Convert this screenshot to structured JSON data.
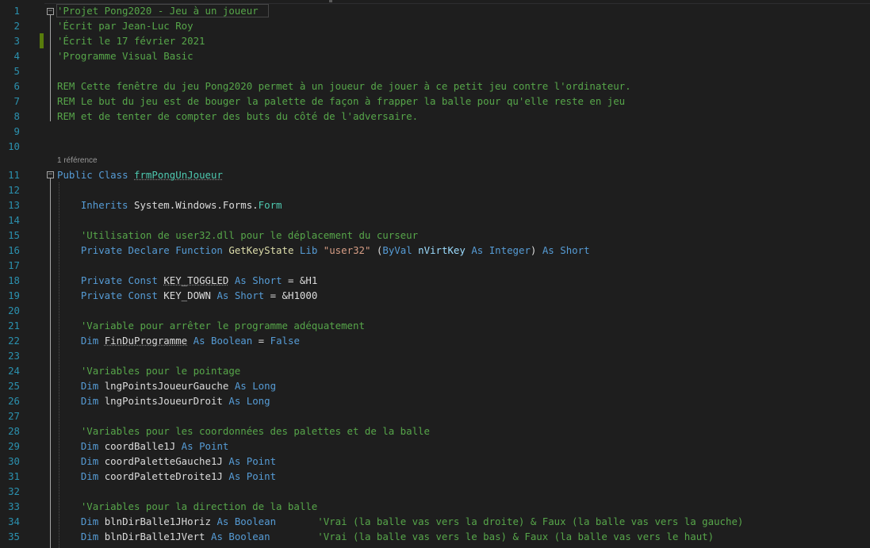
{
  "editor": {
    "codelens": "1 référence",
    "colors": {
      "background": "#1e1e1e",
      "line_number": "#2b91af",
      "keyword": "#569cd6",
      "comment": "#57a64a",
      "type": "#4ec9b0",
      "string": "#d69d85",
      "change_marker": "#587c0c"
    }
  },
  "lines": [
    {
      "n": "1",
      "tokens": [
        {
          "c": "cm",
          "t": "'Projet Pong2020 - Jeu à un joueur"
        }
      ]
    },
    {
      "n": "2",
      "tokens": [
        {
          "c": "cm",
          "t": "'Écrit par Jean-Luc Roy"
        }
      ]
    },
    {
      "n": "3",
      "tokens": [
        {
          "c": "cm",
          "t": "'Écrit le 17 février 2021"
        }
      ]
    },
    {
      "n": "4",
      "tokens": [
        {
          "c": "cm",
          "t": "'Programme Visual Basic"
        }
      ]
    },
    {
      "n": "5",
      "tokens": []
    },
    {
      "n": "6",
      "tokens": [
        {
          "c": "cm",
          "t": "REM Cette fenêtre du jeu Pong2020 permet à un joueur de jouer à ce petit jeu contre l'ordinateur."
        }
      ]
    },
    {
      "n": "7",
      "tokens": [
        {
          "c": "cm",
          "t": "REM Le but du jeu est de bouger la palette de façon à frapper la balle pour qu'elle reste en jeu"
        }
      ]
    },
    {
      "n": "8",
      "tokens": [
        {
          "c": "cm",
          "t": "REM et de tenter de compter des buts du côté de l'adversaire."
        }
      ]
    },
    {
      "n": "9",
      "tokens": []
    },
    {
      "n": "10",
      "tokens": []
    },
    {
      "n": "11",
      "tokens": [
        {
          "c": "kw",
          "t": "Public"
        },
        {
          "c": "tx",
          "t": " "
        },
        {
          "c": "kw",
          "t": "Class"
        },
        {
          "c": "tx",
          "t": " "
        },
        {
          "c": "ty squig",
          "t": "frmPongUnJoueur"
        }
      ]
    },
    {
      "n": "12",
      "tokens": []
    },
    {
      "n": "13",
      "tokens": [
        {
          "c": "tx",
          "t": "    "
        },
        {
          "c": "kw",
          "t": "Inherits"
        },
        {
          "c": "tx",
          "t": " System.Windows.Forms."
        },
        {
          "c": "ty",
          "t": "Form"
        }
      ]
    },
    {
      "n": "14",
      "tokens": []
    },
    {
      "n": "15",
      "tokens": [
        {
          "c": "tx",
          "t": "    "
        },
        {
          "c": "cm",
          "t": "'Utilisation de user32.dll pour le déplacement du curseur"
        }
      ]
    },
    {
      "n": "16",
      "tokens": [
        {
          "c": "tx",
          "t": "    "
        },
        {
          "c": "kw",
          "t": "Private"
        },
        {
          "c": "tx",
          "t": " "
        },
        {
          "c": "kw",
          "t": "Declare"
        },
        {
          "c": "tx",
          "t": " "
        },
        {
          "c": "kw",
          "t": "Function"
        },
        {
          "c": "tx",
          "t": " "
        },
        {
          "c": "fn",
          "t": "GetKeyState"
        },
        {
          "c": "tx",
          "t": " "
        },
        {
          "c": "kw",
          "t": "Lib"
        },
        {
          "c": "tx",
          "t": " "
        },
        {
          "c": "st",
          "t": "\"user32\""
        },
        {
          "c": "tx",
          "t": " ("
        },
        {
          "c": "kw",
          "t": "ByVal"
        },
        {
          "c": "tx",
          "t": " "
        },
        {
          "c": "pm",
          "t": "nVirtKey"
        },
        {
          "c": "tx",
          "t": " "
        },
        {
          "c": "kw",
          "t": "As"
        },
        {
          "c": "tx",
          "t": " "
        },
        {
          "c": "kw",
          "t": "Integer"
        },
        {
          "c": "tx",
          "t": ") "
        },
        {
          "c": "kw",
          "t": "As"
        },
        {
          "c": "tx",
          "t": " "
        },
        {
          "c": "kw",
          "t": "Short"
        }
      ]
    },
    {
      "n": "17",
      "tokens": []
    },
    {
      "n": "18",
      "tokens": [
        {
          "c": "tx",
          "t": "    "
        },
        {
          "c": "kw",
          "t": "Private"
        },
        {
          "c": "tx",
          "t": " "
        },
        {
          "c": "kw",
          "t": "Const"
        },
        {
          "c": "tx",
          "t": " "
        },
        {
          "c": "tx squig",
          "t": "KEY_TOGGLED"
        },
        {
          "c": "tx",
          "t": " "
        },
        {
          "c": "kw",
          "t": "As"
        },
        {
          "c": "tx",
          "t": " "
        },
        {
          "c": "kw",
          "t": "Short"
        },
        {
          "c": "tx",
          "t": " = &H1"
        }
      ]
    },
    {
      "n": "19",
      "tokens": [
        {
          "c": "tx",
          "t": "    "
        },
        {
          "c": "kw",
          "t": "Private"
        },
        {
          "c": "tx",
          "t": " "
        },
        {
          "c": "kw",
          "t": "Const"
        },
        {
          "c": "tx",
          "t": " KEY_DOWN "
        },
        {
          "c": "kw",
          "t": "As"
        },
        {
          "c": "tx",
          "t": " "
        },
        {
          "c": "kw",
          "t": "Short"
        },
        {
          "c": "tx",
          "t": " = &H1000"
        }
      ]
    },
    {
      "n": "20",
      "tokens": []
    },
    {
      "n": "21",
      "tokens": [
        {
          "c": "tx",
          "t": "    "
        },
        {
          "c": "cm",
          "t": "'Variable pour arrêter le programme adéquatement"
        }
      ]
    },
    {
      "n": "22",
      "tokens": [
        {
          "c": "tx",
          "t": "    "
        },
        {
          "c": "kw",
          "t": "Dim"
        },
        {
          "c": "tx",
          "t": " "
        },
        {
          "c": "tx squig",
          "t": "FinDuProgramme"
        },
        {
          "c": "tx",
          "t": " "
        },
        {
          "c": "kw",
          "t": "As"
        },
        {
          "c": "tx",
          "t": " "
        },
        {
          "c": "kw",
          "t": "Boolean"
        },
        {
          "c": "tx",
          "t": " = "
        },
        {
          "c": "kw",
          "t": "False"
        }
      ]
    },
    {
      "n": "23",
      "tokens": []
    },
    {
      "n": "24",
      "tokens": [
        {
          "c": "tx",
          "t": "    "
        },
        {
          "c": "cm",
          "t": "'Variables pour le pointage"
        }
      ]
    },
    {
      "n": "25",
      "tokens": [
        {
          "c": "tx",
          "t": "    "
        },
        {
          "c": "kw",
          "t": "Dim"
        },
        {
          "c": "tx",
          "t": " lngPointsJoueurGauche "
        },
        {
          "c": "kw",
          "t": "As"
        },
        {
          "c": "tx",
          "t": " "
        },
        {
          "c": "kw",
          "t": "Long"
        }
      ]
    },
    {
      "n": "26",
      "tokens": [
        {
          "c": "tx",
          "t": "    "
        },
        {
          "c": "kw",
          "t": "Dim"
        },
        {
          "c": "tx",
          "t": " lngPointsJoueurDroit "
        },
        {
          "c": "kw",
          "t": "As"
        },
        {
          "c": "tx",
          "t": " "
        },
        {
          "c": "kw",
          "t": "Long"
        }
      ]
    },
    {
      "n": "27",
      "tokens": []
    },
    {
      "n": "28",
      "tokens": [
        {
          "c": "tx",
          "t": "    "
        },
        {
          "c": "cm",
          "t": "'Variables pour les coordonnées des palettes et de la balle"
        }
      ]
    },
    {
      "n": "29",
      "tokens": [
        {
          "c": "tx",
          "t": "    "
        },
        {
          "c": "kw",
          "t": "Dim"
        },
        {
          "c": "tx",
          "t": " coordBalle1J "
        },
        {
          "c": "kw",
          "t": "As"
        },
        {
          "c": "tx",
          "t": " "
        },
        {
          "c": "kw",
          "t": "Point"
        }
      ]
    },
    {
      "n": "30",
      "tokens": [
        {
          "c": "tx",
          "t": "    "
        },
        {
          "c": "kw",
          "t": "Dim"
        },
        {
          "c": "tx",
          "t": " coordPaletteGauche1J "
        },
        {
          "c": "kw",
          "t": "As"
        },
        {
          "c": "tx",
          "t": " "
        },
        {
          "c": "kw",
          "t": "Point"
        }
      ]
    },
    {
      "n": "31",
      "tokens": [
        {
          "c": "tx",
          "t": "    "
        },
        {
          "c": "kw",
          "t": "Dim"
        },
        {
          "c": "tx",
          "t": " coordPaletteDroite1J "
        },
        {
          "c": "kw",
          "t": "As"
        },
        {
          "c": "tx",
          "t": " "
        },
        {
          "c": "kw",
          "t": "Point"
        }
      ]
    },
    {
      "n": "32",
      "tokens": []
    },
    {
      "n": "33",
      "tokens": [
        {
          "c": "tx",
          "t": "    "
        },
        {
          "c": "cm",
          "t": "'Variables pour la direction de la balle"
        }
      ]
    },
    {
      "n": "34",
      "tokens": [
        {
          "c": "tx",
          "t": "    "
        },
        {
          "c": "kw",
          "t": "Dim"
        },
        {
          "c": "tx",
          "t": " blnDirBalle1JHoriz "
        },
        {
          "c": "kw",
          "t": "As"
        },
        {
          "c": "tx",
          "t": " "
        },
        {
          "c": "kw",
          "t": "Boolean"
        },
        {
          "c": "tx",
          "t": "       "
        },
        {
          "c": "cm",
          "t": "'Vrai (la balle vas vers la droite) & Faux (la balle vas vers la gauche)"
        }
      ]
    },
    {
      "n": "35",
      "tokens": [
        {
          "c": "tx",
          "t": "    "
        },
        {
          "c": "kw",
          "t": "Dim"
        },
        {
          "c": "tx",
          "t": " blnDirBalle1JVert "
        },
        {
          "c": "kw",
          "t": "As"
        },
        {
          "c": "tx",
          "t": " "
        },
        {
          "c": "kw",
          "t": "Boolean"
        },
        {
          "c": "tx",
          "t": "        "
        },
        {
          "c": "cm",
          "t": "'Vrai (la balle vas vers le bas) & Faux (la balle vas vers le haut)"
        }
      ]
    }
  ]
}
